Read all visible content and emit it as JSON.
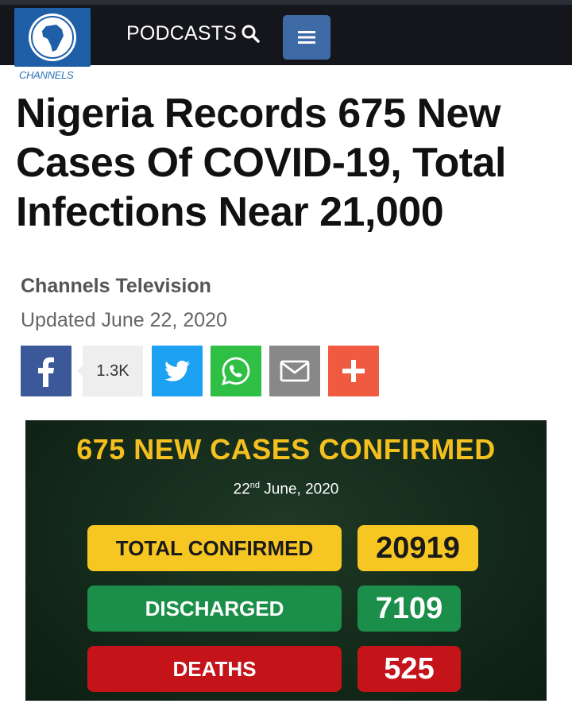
{
  "header": {
    "logo_word": "CHANNELS",
    "nav_podcasts": "PODCASTS",
    "search_icon": "search-icon",
    "menu_icon": "hamburger-menu-icon"
  },
  "article": {
    "headline": "Nigeria Records 675 New Cases Of COVID-19, Total Infections Near 21,000",
    "author": "Channels Television",
    "updated": "Updated June 22, 2020"
  },
  "share": {
    "count": "1.3K",
    "buttons": [
      "facebook-icon",
      "twitter-icon",
      "whatsapp-icon",
      "email-icon",
      "plus-icon"
    ]
  },
  "infographic": {
    "title": "675 NEW CASES CONFIRMED",
    "date_day": "22",
    "date_suffix": "nd",
    "date_rest": " June, 2020",
    "rows": [
      {
        "label": "TOTAL CONFIRMED",
        "value": "20919",
        "color": "#f6c623"
      },
      {
        "label": "DISCHARGED",
        "value": "7109",
        "color": "#1b8f4a"
      },
      {
        "label": "DEATHS",
        "value": "525",
        "color": "#c4141a"
      }
    ]
  },
  "colors": {
    "header_bg": "#14161c",
    "menu_button": "#3e6aa5",
    "accent_yellow": "#f4c020"
  }
}
